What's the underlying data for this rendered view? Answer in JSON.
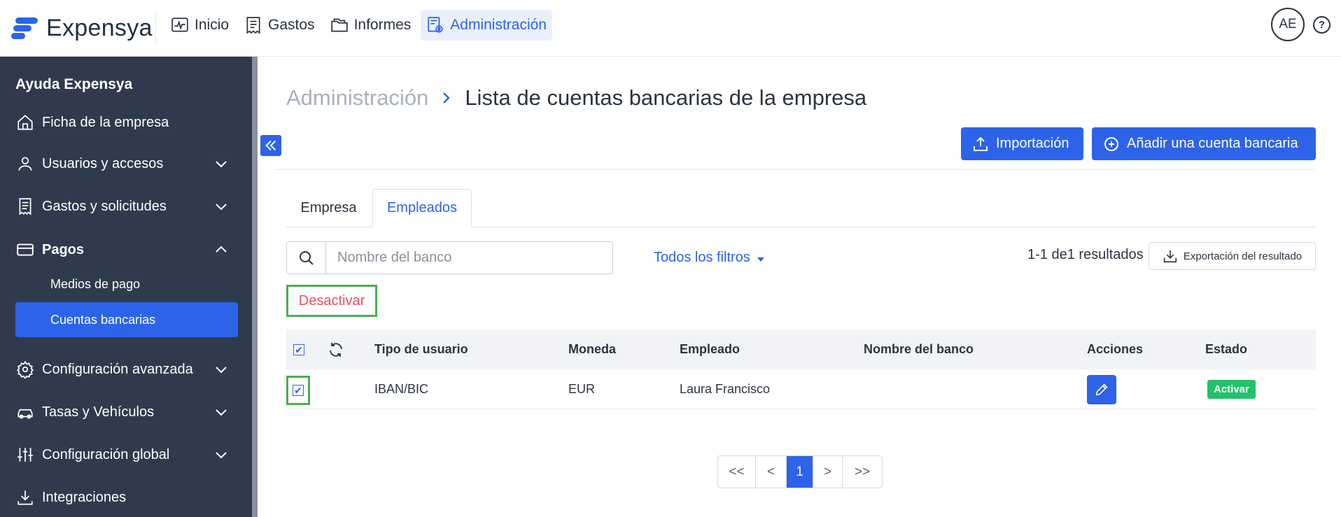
{
  "app": {
    "name": "Expensya"
  },
  "topnav": {
    "items": [
      {
        "label": "Inicio",
        "icon": "pulse-icon",
        "active": false
      },
      {
        "label": "Gastos",
        "icon": "receipt-icon",
        "active": false
      },
      {
        "label": "Informes",
        "icon": "folder-icon",
        "active": false
      },
      {
        "label": "Administración",
        "icon": "admin-settings-icon",
        "active": true
      }
    ],
    "avatar_initials": "AE"
  },
  "sidebar": {
    "title": "Ayuda Expensya",
    "items": [
      {
        "label": "Ficha de la empresa",
        "icon": "home-icon"
      },
      {
        "label": "Usuarios y accesos",
        "icon": "user-icon"
      },
      {
        "label": "Gastos y solicitudes",
        "icon": "receipt-icon"
      },
      {
        "label": "Pagos",
        "icon": "card-icon"
      },
      {
        "label": "Configuración avanzada",
        "icon": "gear-icon"
      },
      {
        "label": "Tasas y Vehículos",
        "icon": "car-icon"
      },
      {
        "label": "Configuración global",
        "icon": "sliders-icon"
      },
      {
        "label": "Integraciones",
        "icon": "download-icon"
      }
    ],
    "payments_sub": [
      {
        "label": "Medios de pago",
        "active": false
      },
      {
        "label": "Cuentas bancarias",
        "active": true
      }
    ]
  },
  "breadcrumb": {
    "root": "Administración",
    "separator": ">",
    "current": "Lista de cuentas bancarias de la empresa"
  },
  "actions": {
    "import_label": "Importación",
    "add_label": "Añadir una cuenta bancaria"
  },
  "tabs": [
    {
      "label": "Empresa",
      "active": false
    },
    {
      "label": "Empleados",
      "active": true
    }
  ],
  "search": {
    "placeholder": "Nombre del banco",
    "value": ""
  },
  "filters_label": "Todos los filtros",
  "results_text": "1-1 de1 resultados",
  "export_label": "Exportación del resultado",
  "deactivate_label": "Desactivar",
  "table": {
    "columns": [
      "Tipo de usuario",
      "Moneda",
      "Empleado",
      "Nombre del banco",
      "Acciones",
      "Estado"
    ],
    "rows": [
      {
        "selected": true,
        "tipo": "IBAN/BIC",
        "moneda": "EUR",
        "empleado": "Laura Francisco",
        "banco": "",
        "estado": "Activar"
      }
    ],
    "header_checkbox": "✔",
    "row_checkbox": "✔"
  },
  "pagination": {
    "first": "<<",
    "prev": "<",
    "page": "1",
    "next": ">",
    "last": ">>"
  },
  "colors": {
    "accent": "#2d63e8",
    "sidebar_bg": "#2f3b4c",
    "danger": "#e45060",
    "success": "#23c16b",
    "highlight": "#4caf50"
  }
}
